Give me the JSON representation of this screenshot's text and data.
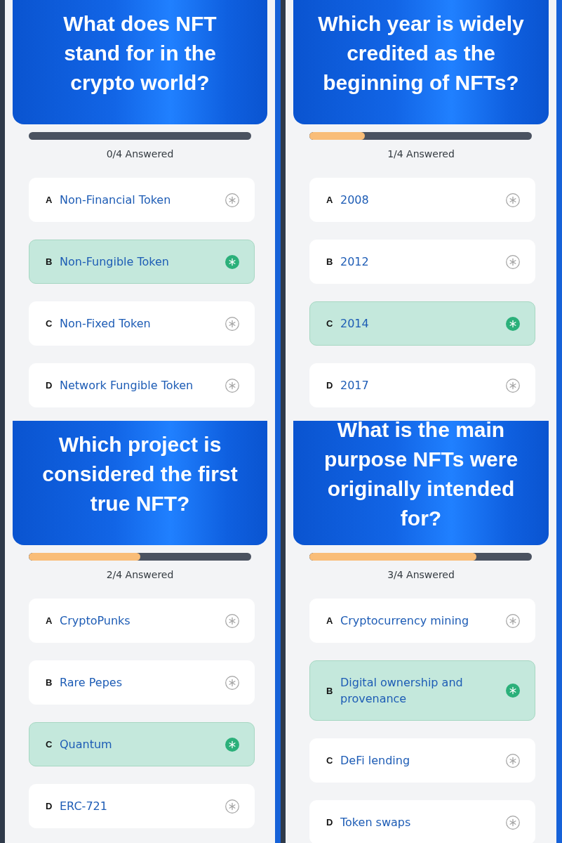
{
  "quizzes": [
    {
      "question": "What does NFT stand for in the crypto world?",
      "progress": {
        "level": 0
      },
      "answered": "0/4 Answered",
      "options": [
        {
          "letter": "A",
          "text": "Non-Financial Token",
          "selected": false
        },
        {
          "letter": "B",
          "text": "Non-Fungible Token",
          "selected": true
        },
        {
          "letter": "C",
          "text": "Non-Fixed Token",
          "selected": false
        },
        {
          "letter": "D",
          "text": "Network Fungible Token",
          "selected": false
        }
      ]
    },
    {
      "question": "Which year is widely credited as the beginning of NFTs?",
      "progress": {
        "level": 0.25
      },
      "answered": "1/4 Answered",
      "options": [
        {
          "letter": "A",
          "text": "2008",
          "selected": false
        },
        {
          "letter": "B",
          "text": "2012",
          "selected": false
        },
        {
          "letter": "C",
          "text": "2014",
          "selected": true
        },
        {
          "letter": "D",
          "text": "2017",
          "selected": false
        }
      ]
    },
    {
      "question": "Which project is considered the first true NFT?",
      "progress": {
        "level": 0.5
      },
      "answered": "2/4 Answered",
      "options": [
        {
          "letter": "A",
          "text": "CryptoPunks",
          "selected": false
        },
        {
          "letter": "B",
          "text": "Rare Pepes",
          "selected": false
        },
        {
          "letter": "C",
          "text": "Quantum",
          "selected": true
        },
        {
          "letter": "D",
          "text": "ERC-721",
          "selected": false
        }
      ]
    },
    {
      "question": "What is the main purpose NFTs were originally intended for?",
      "progress": {
        "level": 0.75
      },
      "answered": "3/4 Answered",
      "options": [
        {
          "letter": "A",
          "text": "Cryptocurrency mining",
          "selected": false
        },
        {
          "letter": "B",
          "text": "Digital ownership and provenance",
          "selected": true
        },
        {
          "letter": "C",
          "text": "DeFi lending",
          "selected": false
        },
        {
          "letter": "D",
          "text": "Token swaps",
          "selected": false
        }
      ]
    }
  ]
}
